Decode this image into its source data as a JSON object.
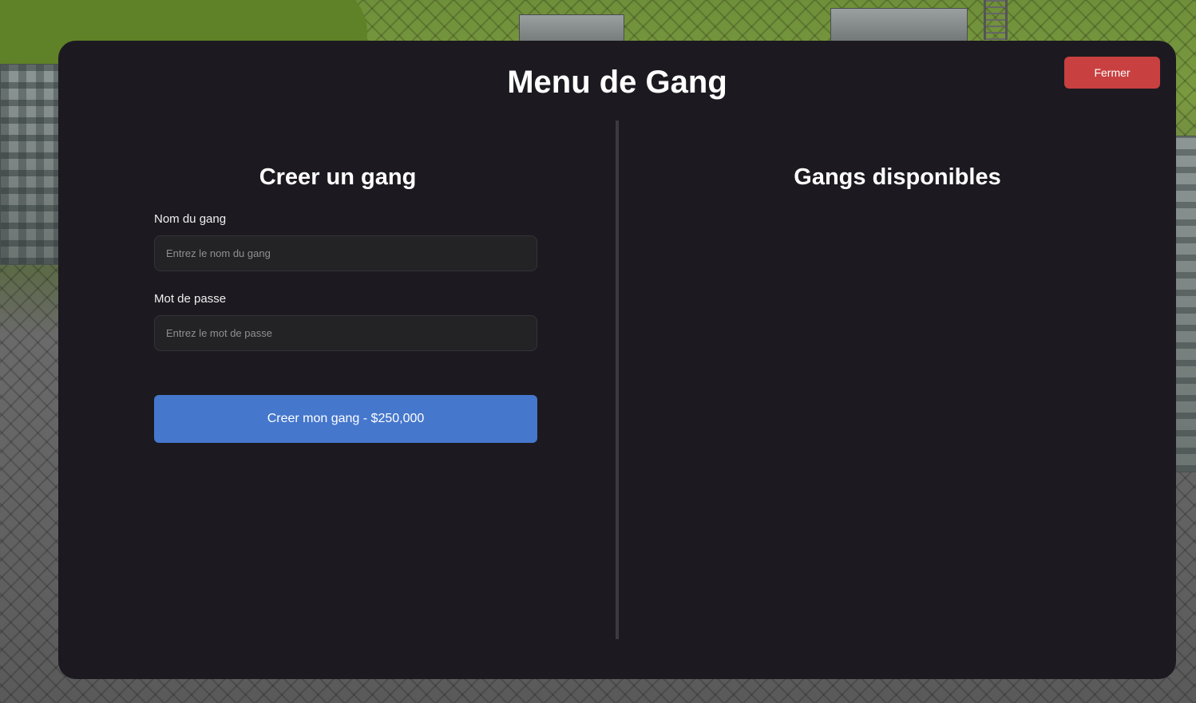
{
  "modal": {
    "title": "Menu de Gang",
    "close_label": "Fermer"
  },
  "create_section": {
    "title": "Creer un gang",
    "name_label": "Nom du gang",
    "name_placeholder": "Entrez le nom du gang",
    "name_value": "",
    "password_label": "Mot de passe",
    "password_placeholder": "Entrez le mot de passe",
    "password_value": "",
    "submit_label": "Creer mon gang - $250,000"
  },
  "available_section": {
    "title": "Gangs disponibles",
    "gangs": []
  },
  "colors": {
    "panel_background": "#1c1a20",
    "close_button": "#c94040",
    "submit_button": "#4577cc"
  }
}
